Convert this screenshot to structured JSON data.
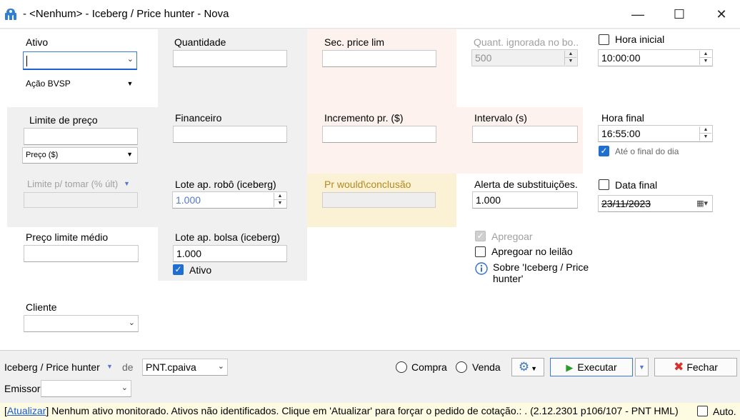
{
  "window": {
    "title": "- <Nenhum> - Iceberg / Price hunter - Nova",
    "minimize": "—",
    "maximize": "☐",
    "close": "✕"
  },
  "form": {
    "ativo": {
      "label": "Ativo",
      "value": "",
      "type_select": "Ação BVSP"
    },
    "quantidade": {
      "label": "Quantidade",
      "value": ""
    },
    "sec_price_lim": {
      "label": "Sec. price lim",
      "value": ""
    },
    "quant_ignorada": {
      "label": "Quant. ignorada no bo...",
      "value": "500"
    },
    "hora_inicial": {
      "label": "Hora inicial",
      "value": "10:00:00",
      "checked": false
    },
    "limite_preco": {
      "label": "Limite de preço",
      "value": "",
      "type_select": "Preço ($)"
    },
    "financeiro": {
      "label": "Financeiro",
      "value": ""
    },
    "incremento": {
      "label": "Incremento pr. ($)",
      "value": ""
    },
    "intervalo": {
      "label": "Intervalo (s)",
      "value": ""
    },
    "hora_final": {
      "label": "Hora final",
      "value": "16:55:00",
      "ate_final_label": "Até o final do dia",
      "ate_final_checked": true
    },
    "limite_tomar": {
      "label": "Limite p/ tomar (% últ)",
      "value": ""
    },
    "lote_robo": {
      "label": "Lote ap. robô (iceberg)",
      "value": "1.000"
    },
    "pr_would": {
      "label": "Pr would\\conclusão",
      "value": ""
    },
    "alerta": {
      "label": "Alerta de substituições.",
      "value": "1.000"
    },
    "data_final": {
      "label": "Data final",
      "value": "23/11/2023",
      "checked": false
    },
    "preco_limite_medio": {
      "label": "Preço limite médio",
      "value": ""
    },
    "lote_bolsa": {
      "label": "Lote ap. bolsa (iceberg)",
      "value": "1.000",
      "ativo_label": "Ativo",
      "ativo_checked": true
    },
    "apregoar": {
      "label": "Apregoar",
      "checked": true,
      "disabled": true
    },
    "apregoar_leilao": {
      "label": "Apregoar no leilão",
      "checked": false
    },
    "sobre": {
      "line1": "Sobre 'Iceberg / Price",
      "line2": "hunter'"
    },
    "cliente": {
      "label": "Cliente",
      "value": ""
    }
  },
  "toolbar": {
    "strategy": "Iceberg / Price hunter",
    "de_label": "de",
    "account": "PNT.cpaiva",
    "compra_label": "Compra",
    "venda_label": "Venda",
    "executar_label": "Executar",
    "fechar_label": "Fechar",
    "emissor_label": "Emissor",
    "emissor_value": ""
  },
  "status": {
    "link": "Atualizar",
    "message": " Nenhum ativo monitorado. Ativos não identificados. Clique em 'Atualizar' para forçar o pedido de cotação.: .  (2.12.2301 p106/107 - PNT HML)",
    "auto_label": "Auto."
  },
  "colors": {
    "accent": "#1f6fcf",
    "panel_gray": "#f0f0f0",
    "panel_pink": "#fdf2ee",
    "panel_yellow": "#fbf2d5",
    "status_bg": "#fdfbe2",
    "close_red": "#d9302b",
    "play_green": "#2a9a2a"
  }
}
